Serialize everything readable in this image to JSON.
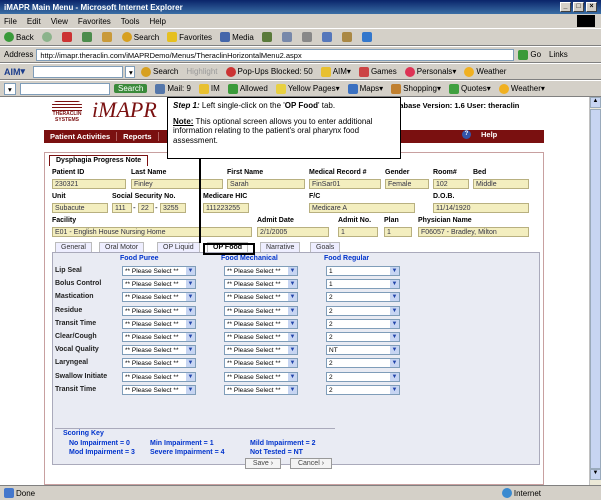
{
  "window": {
    "title": "iMAPR Main Menu - Microsoft Internet Explorer"
  },
  "menubar": [
    "File",
    "Edit",
    "View",
    "Favorites",
    "Tools",
    "Help"
  ],
  "toolbar": {
    "back": "Back",
    "search": "Search",
    "favorites": "Favorites",
    "media": "Media"
  },
  "address": {
    "label": "Address",
    "url": "http://imapr.theraclin.com/iMAPRDemo/Menus/TheraclinHorizontalMenu2.aspx",
    "go": "Go",
    "links": "Links"
  },
  "aimbar": {
    "aim": "AIM",
    "search": "Search",
    "highlight": "Highlight",
    "popups": "Pop-Ups Blocked: 50",
    "aim2": "AIM",
    "games": "Games",
    "personals": "Personals",
    "weather": "Weather"
  },
  "searchbar": {
    "search": "Search",
    "mail": "Mail: 9",
    "im": "IM",
    "allowed": "Allowed",
    "yellow": "Yellow Pages",
    "maps": "Maps",
    "shopping": "Shopping",
    "quotes": "Quotes",
    "weather": "Weather"
  },
  "app": {
    "logo_small": "THERACLIN SYSTEMS",
    "logo": "iMAPR",
    "version": "on Database Version: 1.6 User: theraclin",
    "nav": [
      "Patient Activities",
      "Reports"
    ],
    "help": "Help",
    "form_tab": "Dysphagia Progress Note"
  },
  "patient": {
    "labels": {
      "id": "Patient ID",
      "last": "Last Name",
      "first": "First Name",
      "mrn": "Medical Record #",
      "gender": "Gender",
      "room": "Room#",
      "bed": "Bed",
      "unit": "Unit",
      "ssn": "Social Security No.",
      "medicare": "Medicare HIC",
      "fc": "F/C",
      "dob": "D.O.B.",
      "facility": "Facility",
      "admit": "Admit Date",
      "admitno": "Admit No.",
      "plan": "Plan",
      "physician": "Physician Name"
    },
    "values": {
      "id": "230321",
      "last": "Finley",
      "first": "Sarah",
      "mrn": "FinSar01",
      "gender": "Female",
      "room": "102",
      "bed": "Middle",
      "unit": "Subacute",
      "ssn1": "111",
      "ssn2": "22",
      "ssn3": "3255",
      "medicare": "111223255",
      "fc": "Medicare A",
      "dob": "11/14/1920",
      "facility": "E01 - English House Nursing Home",
      "admit": "2/1/2005",
      "admitno": "1",
      "plan": "1",
      "physician": "F06057 - Bradley, Milton"
    }
  },
  "subtabs": [
    "General",
    "Oral Motor",
    "OP Liquid",
    "OP Food",
    "Narrative",
    "Goals"
  ],
  "grid": {
    "columns": [
      "Food Puree",
      "Food Mechanical",
      "Food Regular"
    ],
    "rows": [
      {
        "label": "Lip Seal",
        "values": [
          "** Please Select **",
          "** Please Select **",
          "1"
        ]
      },
      {
        "label": "Bolus Control",
        "values": [
          "** Please Select **",
          "** Please Select **",
          "1"
        ]
      },
      {
        "label": "Mastication",
        "values": [
          "** Please Select **",
          "** Please Select **",
          "2"
        ]
      },
      {
        "label": "Residue",
        "values": [
          "** Please Select **",
          "** Please Select **",
          "2"
        ]
      },
      {
        "label": "Transit Time",
        "values": [
          "** Please Select **",
          "** Please Select **",
          "2"
        ]
      },
      {
        "label": "Clear/Cough",
        "values": [
          "** Please Select **",
          "** Please Select **",
          "2"
        ]
      },
      {
        "label": "Vocal Quality",
        "values": [
          "** Please Select **",
          "** Please Select **",
          "NT"
        ]
      },
      {
        "label": "Laryngeal",
        "values": [
          "** Please Select **",
          "** Please Select **",
          "2"
        ]
      },
      {
        "label": "Swallow Initiate",
        "values": [
          "** Please Select **",
          "** Please Select **",
          "2"
        ]
      },
      {
        "label": "Transit Time",
        "values": [
          "** Please Select **",
          "** Please Select **",
          "2"
        ]
      }
    ]
  },
  "scoring": {
    "title": "Scoring Key",
    "line1": [
      "No Impairment = 0",
      "Min Impairment = 1",
      "Mild Impairment = 2"
    ],
    "line2": [
      "Mod Impairment = 3",
      "Severe Impairment = 4",
      "Not Tested = NT"
    ]
  },
  "buttons": {
    "save": "Save",
    "cancel": "Cancel"
  },
  "callout": {
    "step": "Step 1:",
    "step_text": " Left single-click on the '",
    "step_bold": "OP Food",
    "step_end": "' tab.",
    "note": "Note:",
    "note_text": " This optional screen allows you to enter additional information relating to the patient's oral pharynx food assessment."
  },
  "status": {
    "left": "Done",
    "zone": "Internet"
  }
}
